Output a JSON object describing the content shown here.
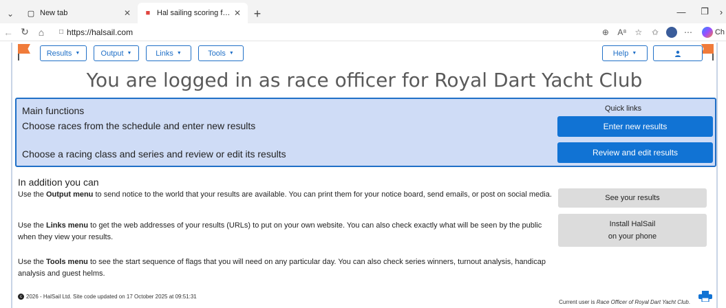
{
  "browser": {
    "tabs": [
      {
        "title": "New tab",
        "active": false
      },
      {
        "title": "Hal sailing scoring for Royal Dart Y",
        "active": true
      }
    ],
    "url": "https://halsail.com",
    "copilot_label": "Ch"
  },
  "menubar": {
    "results": "Results",
    "output": "Output",
    "links": "Links",
    "tools": "Tools",
    "help": "Help"
  },
  "page": {
    "title": "You are logged in as race officer for Royal Dart Yacht Club"
  },
  "main_functions": {
    "title": "Main functions",
    "row1": "Choose races from the schedule and enter new results",
    "row2": "Choose a racing class and series and review or edit its results",
    "quick_links_title": "Quick links",
    "enter_btn": "Enter new results",
    "review_btn": "Review and edit results"
  },
  "additional": {
    "title": "In addition you can",
    "p1_pre": "Use the ",
    "p1_bold": "Output menu",
    "p1_post": " to send notice to the world that your results are available. You can print them for your notice board, send emails, or post on social media.",
    "p2_pre": "Use the ",
    "p2_bold": "Links menu",
    "p2_post": " to get the web addresses of your results (URLs) to put on your own website. You can also check exactly what will be seen by the public when they view your results.",
    "p3_pre": "Use the ",
    "p3_bold": "Tools menu",
    "p3_post": " to see the start sequence of flags that you will need on any particular day. You can also check series winners, turnout analysis, handicap analysis and guest helms.",
    "see_results_btn": "See your results",
    "install_line1": "Install HalSail",
    "install_line2": "on your phone"
  },
  "footer": {
    "copyright": "2026 - HalSail Ltd. Site code updated on 17 October 2025 at 09:51:31",
    "user_prefix": "Current user is ",
    "user_name": "Race Officer of Royal Dart Yacht Club",
    "user_suffix": "."
  },
  "colors": {
    "primary": "#1173d4",
    "panel_bg": "#cfdcf6",
    "flag": "#f07b3a"
  }
}
